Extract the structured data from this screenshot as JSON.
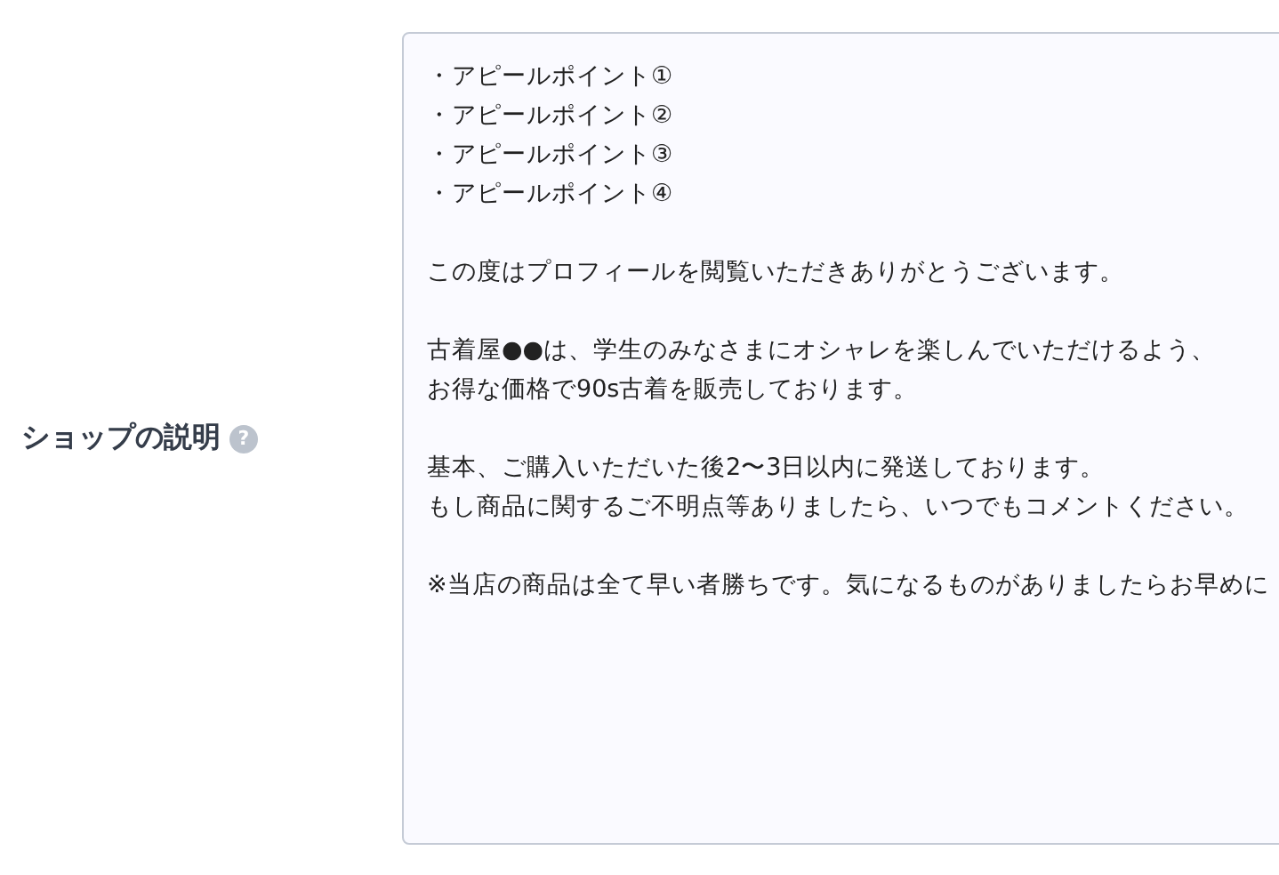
{
  "field": {
    "label": "ショップの説明",
    "help_icon": "?",
    "paragraphs": [
      [
        "・アピールポイント①",
        "・アピールポイント②",
        "・アピールポイント③",
        "・アピールポイント④"
      ],
      [
        "この度はプロフィールを閲覧いただきありがとうございます。"
      ],
      [
        "古着屋●●は、学生のみなさまにオシャレを楽しんでいただけるよう、",
        "お得な価格で90s古着を販売しております。"
      ],
      [
        "基本、ご購入いただいた後2〜3日以内に発送しております。",
        "もし商品に関するご不明点等ありましたら、いつでもコメントください。"
      ],
      [
        "※当店の商品は全て早い者勝ちです。気になるものがありましたらお早めに"
      ]
    ]
  }
}
